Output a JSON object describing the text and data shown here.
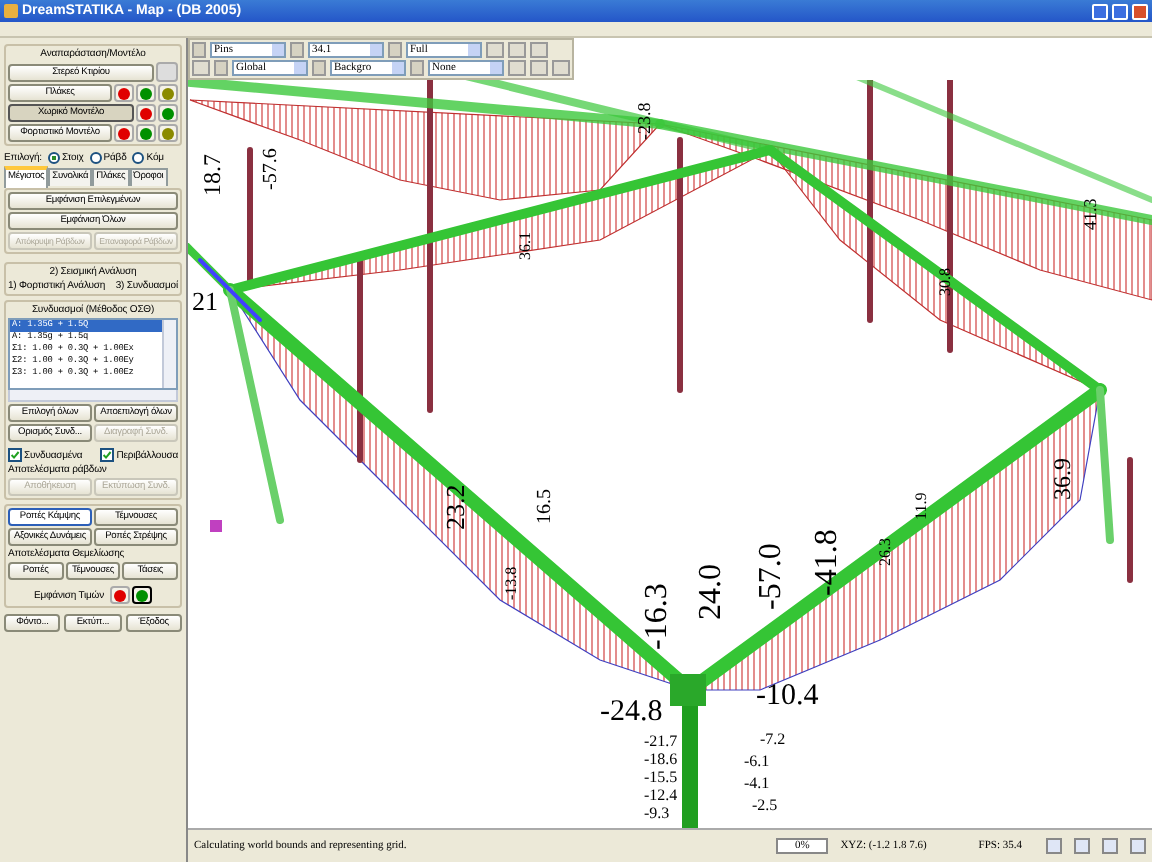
{
  "window": {
    "title": "DreamSTATIKA - Map - (DB 2005)"
  },
  "sidebar": {
    "model_group": {
      "title": "Αναπαράσταση/Μοντέλο",
      "rows": [
        {
          "label": "Στερεό Κτιρίου",
          "pressed": false,
          "dots": []
        },
        {
          "label": "Πλάκες",
          "pressed": false,
          "dots": [
            {
              "color": "#e00000"
            },
            {
              "color": "#009000"
            },
            {
              "color": "#8a8a00"
            }
          ]
        },
        {
          "label": "Χωρικό Μοντέλο",
          "pressed": true,
          "dots": [
            {
              "color": "#e00000"
            },
            {
              "color": "#009000"
            }
          ]
        },
        {
          "label": "Φορτιστικό Μοντέλο",
          "pressed": false,
          "dots": [
            {
              "color": "#e00000"
            },
            {
              "color": "#009000"
            },
            {
              "color": "#8a8a00"
            }
          ]
        }
      ]
    },
    "selection": {
      "label": "Επιλογή:",
      "options": [
        {
          "label": "Στοιχ",
          "selected": true
        },
        {
          "label": "Ράβδ",
          "selected": false
        },
        {
          "label": "Κόμ",
          "selected": false
        }
      ]
    },
    "tabs": [
      {
        "label": "Μέγιστος",
        "selected": true
      },
      {
        "label": "Συνολικά",
        "selected": false
      },
      {
        "label": "Πλάκες",
        "selected": false
      },
      {
        "label": "Όροφοι",
        "selected": false
      }
    ],
    "show_buttons": [
      {
        "label": "Εμφάνιση Επιλεγμένων",
        "disabled": false
      },
      {
        "label": "Εμφάνιση Όλων",
        "disabled": false
      }
    ],
    "hidden_buttons": [
      {
        "label": "Απόκρυψη Ράβδων",
        "disabled": true
      },
      {
        "label": "Επαναφορά Ράβδων",
        "disabled": true
      }
    ],
    "analysis": {
      "items": [
        "2) Σεισμική Ανάλυση",
        "1) Φορτιστική Ανάλυση",
        "3) Συνδυασμοί"
      ]
    },
    "combinations": {
      "title": "Συνδυασμοί (Μέθοδος ΟΣΘ)",
      "rows": [
        {
          "text": "A: 1.35G + 1.5Q",
          "selected": true
        },
        {
          "text": "A: 1.35g + 1.5q",
          "selected": false
        },
        {
          "text": "Σ1: 1.00 + 0.3Q + 1.00Ex",
          "selected": false
        },
        {
          "text": "Σ2: 1.00 + 0.3Q + 1.00Ey",
          "selected": false
        },
        {
          "text": "Σ3: 1.00 + 0.3Q + 1.00Ez",
          "selected": false
        }
      ]
    },
    "select_buttons": [
      {
        "label": "Επιλογή όλων",
        "disabled": false
      },
      {
        "label": "Αποεπιλογή όλων",
        "disabled": false
      },
      {
        "label": "Ορισμός Συνδ...",
        "disabled": false
      },
      {
        "label": "Διαγραφή Συνδ.",
        "disabled": true
      }
    ],
    "checks": [
      {
        "label": "Συνδυασμένα",
        "checked": true
      },
      {
        "label": "Περιβάλλουσα",
        "checked": true
      }
    ],
    "bar_results": {
      "title": "Αποτελέσματα ράβδων",
      "buttons": [
        {
          "label": "Αποθήκευση",
          "disabled": true
        },
        {
          "label": "Εκτύπωση Συνδ.",
          "disabled": true
        }
      ]
    },
    "force_buttons": [
      {
        "label": "Ροπές Κάμψης",
        "selected": true
      },
      {
        "label": "Τέμνουσες",
        "selected": false
      },
      {
        "label": "Αξονικές Δυνάμεις",
        "selected": false
      },
      {
        "label": "Ροπές Στρέψης",
        "selected": false
      }
    ],
    "foundation": {
      "title": "Αποτελέσματα Θεμελίωσης",
      "buttons": [
        {
          "label": "Ροπές",
          "selected": false
        },
        {
          "label": "Τέμνουσες",
          "selected": false
        },
        {
          "label": "Τάσεις",
          "selected": false
        }
      ]
    },
    "show_values": {
      "label": "Εμφάνιση Τιμών",
      "dots": [
        {
          "color": "#e00000",
          "selected": false
        },
        {
          "color": "#009000",
          "selected": true
        }
      ]
    },
    "bottom_buttons": [
      "Φόντο...",
      "Εκτύπ...",
      "Έξοδος"
    ]
  },
  "toolbar": {
    "rows": [
      [
        "Pins",
        "34.1",
        "Full"
      ],
      [
        "Global",
        "Backgro",
        "None"
      ]
    ]
  },
  "view": {
    "labels": [
      "-16.3",
      "24.0",
      "-57.0",
      "-41.8",
      "-24.8",
      "-10.4",
      "-21.7",
      "-18.6",
      "-15.5",
      "-12.4",
      "-9.3",
      "-7.2",
      "-6.1",
      "-4.1",
      "-2.5",
      "23.2",
      "16.5",
      "11.9",
      "26.3",
      "36.9",
      "41.3",
      "-57.6",
      "18.7",
      "21",
      "30.8",
      "-13.8",
      "36.1",
      "-23.8"
    ]
  },
  "status_bar": {
    "message": "Calculating world bounds and representing grid.",
    "progress": "0%",
    "coords": "XYZ: (-1.2 1.8 7.6)",
    "fps": "FPS: 35.4"
  }
}
